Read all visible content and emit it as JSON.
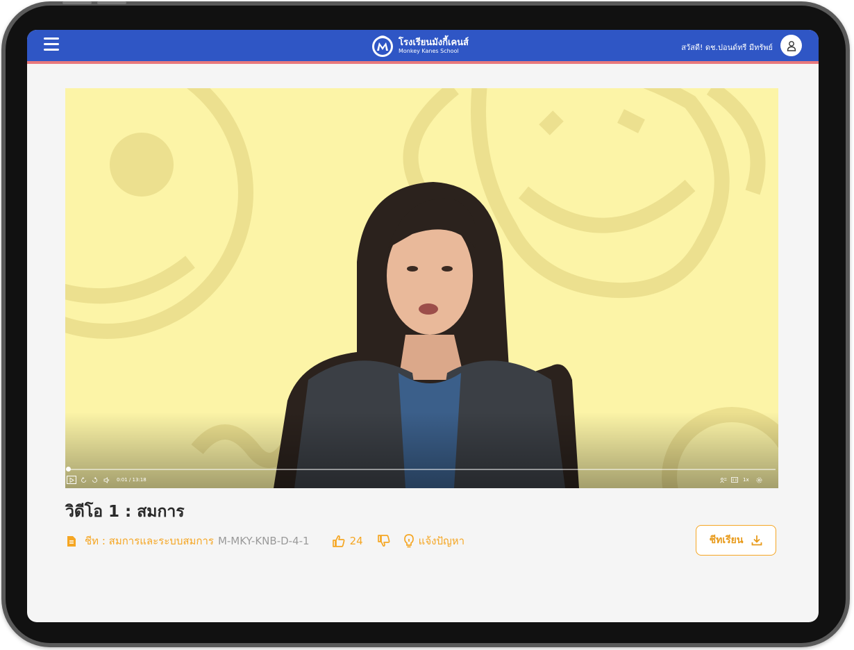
{
  "header": {
    "menu_icon": "hamburger-menu-icon",
    "school_name_th": "โรงเรียนมังกี้เคนส์",
    "school_name_en": "Monkey Kanes School",
    "greeting": "สวัสดี! ดช.ปอนด์ทรี มีทรัพย์",
    "avatar_icon": "user-icon",
    "bar_color": "#2f56c5",
    "accent_color": "#e8787c"
  },
  "player": {
    "time": "0:01 / 13:18",
    "speed": "1x",
    "progress": 0.001,
    "background_color": "#fcf4a7"
  },
  "video": {
    "title": "วิดีโอ 1 : สมการ",
    "sheet_label": "ชีท : สมการและระบบสมการ",
    "sheet_code": "M-MKY-KNB-D-4-1",
    "likes": "24",
    "report_label": "แจ้งปัญหา",
    "download_label": "ชีทเรียน",
    "accent_color": "#f5a623"
  }
}
